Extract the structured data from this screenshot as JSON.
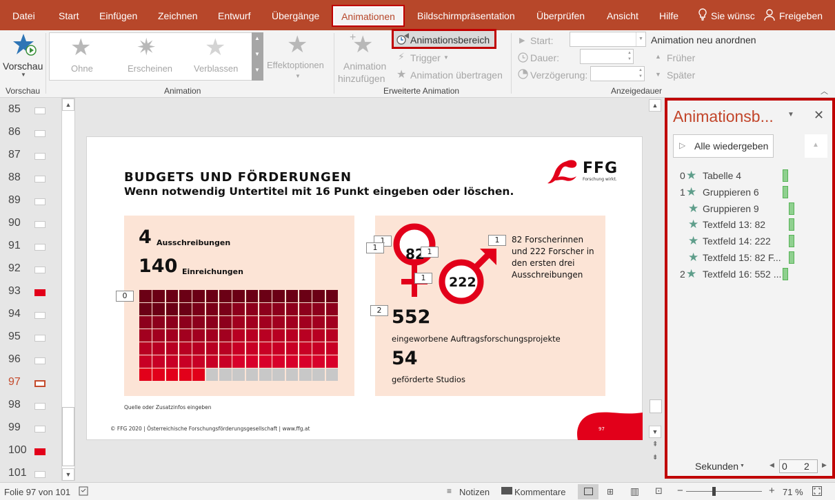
{
  "menu": {
    "tabs": [
      "Datei",
      "Start",
      "Einfügen",
      "Zeichnen",
      "Entwurf",
      "Übergänge",
      "Animationen",
      "Bildschirmpräsentation",
      "Überprüfen",
      "Ansicht",
      "Hilfe"
    ],
    "tell_me": "Sie wünsc",
    "share": "Freigeben"
  },
  "ribbon": {
    "preview": {
      "label": "Vorschau",
      "group": "Vorschau"
    },
    "animation_gallery": {
      "items": [
        "Ohne",
        "Erscheinen",
        "Verblassen"
      ],
      "group": "Animation"
    },
    "effect_options": "Effektoptionen",
    "add_animation": {
      "line1": "Animation",
      "line2": "hinzufügen"
    },
    "animation_pane_btn": "Animationsbereich",
    "trigger": "Trigger",
    "animation_painter": "Animation übertragen",
    "advanced_group": "Erweiterte Animation",
    "start_label": "Start:",
    "duration_label": "Dauer:",
    "delay_label": "Verzögerung:",
    "reorder": "Animation neu anordnen",
    "earlier": "Früher",
    "later": "Später",
    "timing_group": "Anzeigedauer"
  },
  "thumbs": {
    "items": [
      {
        "n": "85",
        "style": "plain"
      },
      {
        "n": "86",
        "style": "plain"
      },
      {
        "n": "87",
        "style": "plain"
      },
      {
        "n": "88",
        "style": "plain"
      },
      {
        "n": "89",
        "style": "plain"
      },
      {
        "n": "90",
        "style": "plain"
      },
      {
        "n": "91",
        "style": "plain"
      },
      {
        "n": "92",
        "style": "plain"
      },
      {
        "n": "93",
        "style": "red"
      },
      {
        "n": "94",
        "style": "plain"
      },
      {
        "n": "95",
        "style": "plain"
      },
      {
        "n": "96",
        "style": "plain"
      },
      {
        "n": "97",
        "style": "selected"
      },
      {
        "n": "98",
        "style": "plain"
      },
      {
        "n": "99",
        "style": "plain"
      },
      {
        "n": "100",
        "style": "red"
      },
      {
        "n": "101",
        "style": "plain"
      }
    ]
  },
  "slide": {
    "title": "BUDGETS UND FÖRDERUNGEN",
    "subtitle": "Wenn notwendig Untertitel mit 16 Punkt eingeben oder löschen.",
    "logo_text": "FFG",
    "logo_sub": "Forschung wirkt.",
    "left": {
      "n1": "4",
      "n1_label": "Ausschreibungen",
      "n2": "140",
      "n2_label": "Einreichungen"
    },
    "right": {
      "female": "82",
      "male": "222",
      "desc": [
        "82 Forscherinnen",
        "und 222 Forscher in",
        "den ersten drei",
        "Ausschreibungen"
      ],
      "n1": "552",
      "n1_label": "eingeworbene Auftragsforschungsprojekte",
      "n2": "54",
      "n2_label": "geförderte Studios"
    },
    "source": "Quelle oder Zusatzinfos eingeben",
    "footer": "© FFG 2020 | Österreichische Forschungsförderungsgesellschaft | www.ffg.at",
    "page": "97",
    "tags": {
      "t0": "0",
      "t1a": "1",
      "t1b": "1",
      "t1c": "1",
      "t1d": "1",
      "t1e": "1",
      "t2": "2"
    },
    "waffle": {
      "cols": 15,
      "rows": 7,
      "last_row_red": 5
    }
  },
  "pane": {
    "title": "Animationsb...",
    "play_all": "Alle wiedergeben",
    "items": [
      {
        "idx": "0",
        "label": "Tabelle 4",
        "indent": 0
      },
      {
        "idx": "1",
        "label": "Gruppieren 6",
        "indent": 0
      },
      {
        "idx": "",
        "label": "Gruppieren 9",
        "indent": 1
      },
      {
        "idx": "",
        "label": "Textfeld 13: 82",
        "indent": 1
      },
      {
        "idx": "",
        "label": "Textfeld 14: 222",
        "indent": 1
      },
      {
        "idx": "",
        "label": "Textfeld 15: 82 F...",
        "indent": 1
      },
      {
        "idx": "2",
        "label": "Textfeld 16: 552 ...",
        "indent": 0
      }
    ],
    "seconds": "Sekunden",
    "scale_from": "0",
    "scale_to": "2"
  },
  "status": {
    "slide_of": "Folie 97 von 101",
    "notes": "Notizen",
    "comments": "Kommentare",
    "zoom": "71 %"
  },
  "colors": {
    "accent": "#b7472a",
    "ffg_red": "#e2001a",
    "highlight_box": "#c00000",
    "panel": "#fce4d6"
  }
}
